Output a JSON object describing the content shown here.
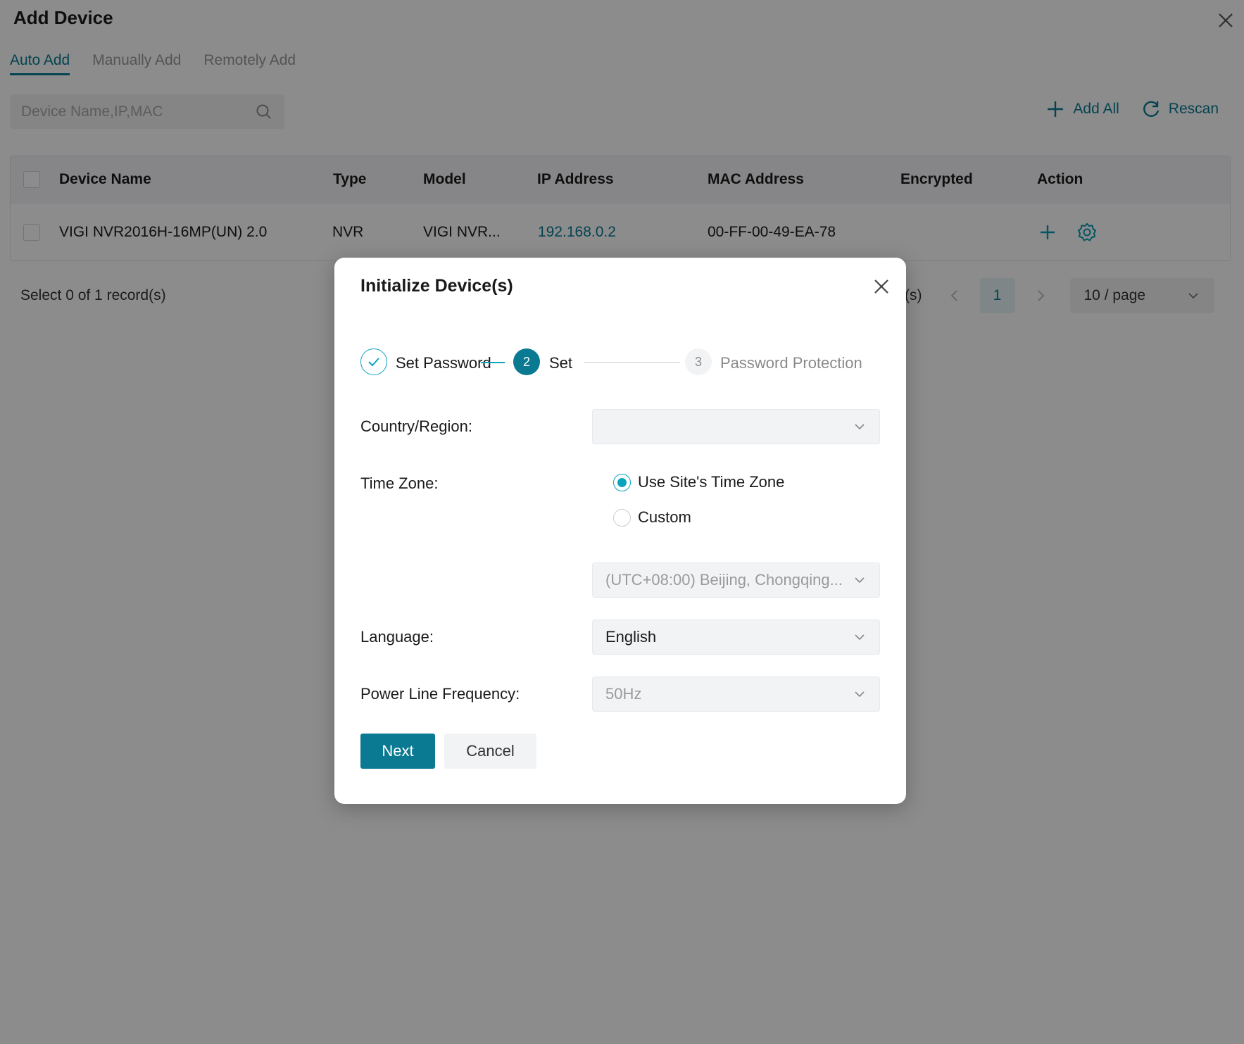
{
  "page": {
    "title": "Add Device",
    "tabs": [
      {
        "label": "Auto Add",
        "active": true
      },
      {
        "label": "Manually Add",
        "active": false
      },
      {
        "label": "Remotely Add",
        "active": false
      }
    ],
    "search": {
      "placeholder": "Device Name,IP,MAC"
    },
    "toolbar": {
      "add_all_label": "Add All",
      "rescan_label": "Rescan"
    },
    "table": {
      "headers": [
        "Device Name",
        "Type",
        "Model",
        "IP Address",
        "MAC Address",
        "Encrypted",
        "Action"
      ],
      "rows": [
        {
          "device_name": "VIGI NVR2016H-16MP(UN) 2.0",
          "type": "NVR",
          "model": "VIGI NVR...",
          "ip": "192.168.0.2",
          "mac": "00-FF-00-49-EA-78",
          "encrypted": ""
        }
      ]
    },
    "records_text": "Select 0 of 1 record(s)",
    "pagination": {
      "suffix": "(s)",
      "current_page": "1",
      "page_size": "10 / page"
    }
  },
  "modal": {
    "title": "Initialize Device(s)",
    "steps": [
      {
        "number": "1",
        "label": "Set Password",
        "state": "done"
      },
      {
        "number": "2",
        "label": "Set",
        "state": "active"
      },
      {
        "number": "3",
        "label": "Password Protection",
        "state": "pending"
      }
    ],
    "fields": {
      "country_label": "Country/Region:",
      "country_value": "",
      "timezone_label": "Time Zone:",
      "timezone_options": [
        {
          "label": "Use Site's Time Zone",
          "checked": true
        },
        {
          "label": "Custom",
          "checked": false
        }
      ],
      "timezone_value": "(UTC+08:00) Beijing, Chongqing...",
      "language_label": "Language:",
      "language_value": "English",
      "power_label": "Power Line Frequency:",
      "power_value": "50Hz"
    },
    "buttons": {
      "next_label": "Next",
      "cancel_label": "Cancel"
    }
  },
  "colors": {
    "accent": "#0a7a93",
    "radio_accent": "#0aa4bd",
    "overlay": "rgba(0,0,0,0.45)"
  }
}
